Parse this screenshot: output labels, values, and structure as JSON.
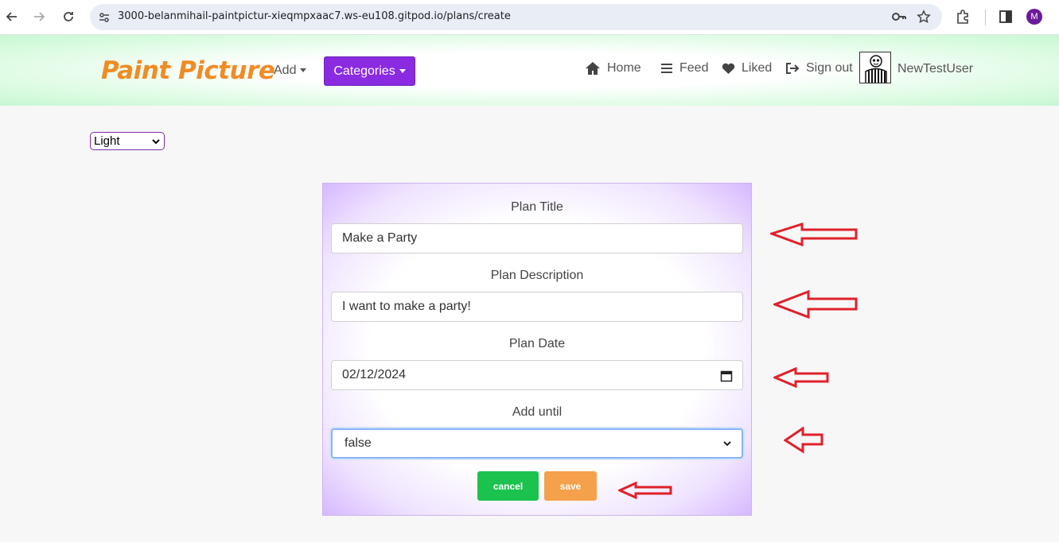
{
  "browser": {
    "url": "3000-belanmihail-paintpictur-xieqmpxaac7.ws-eu108.gitpod.io/plans/create",
    "profile_initial": "M"
  },
  "navbar": {
    "brand": "Paint Picture",
    "add_label": "Add",
    "categories_label": "Categories",
    "links": {
      "home": "Home",
      "feed": "Feed",
      "liked": "Liked",
      "signout": "Sign out"
    },
    "username": "NewTestUser"
  },
  "theme": {
    "selected": "Light"
  },
  "form": {
    "title_label": "Plan Title",
    "title_value": "Make a Party",
    "description_label": "Plan Description",
    "description_value": "I want to make a party!",
    "date_label": "Plan Date",
    "date_value": "02/12/2024",
    "until_label": "Add until",
    "until_value": "false",
    "cancel_label": "cancel",
    "save_label": "save"
  },
  "colors": {
    "brand": "#f08c24",
    "categories_button": "#8a2be2",
    "cancel_button": "#1cc24e",
    "save_button": "#f5a04a",
    "annotation_arrow": "#e0202a"
  }
}
